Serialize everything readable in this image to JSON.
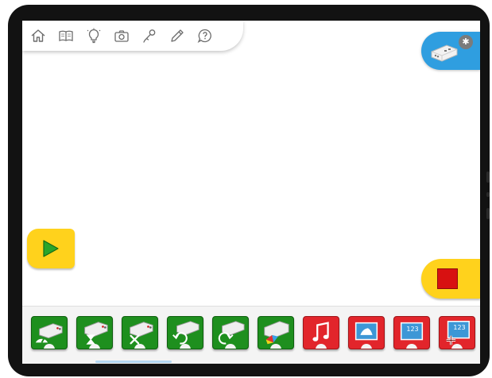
{
  "toolbar": {
    "icons": [
      "home-icon",
      "book-icon",
      "lightbulb-icon",
      "camera-icon",
      "microphone-icon",
      "pencil-icon",
      "help-icon"
    ]
  },
  "hub": {
    "icon": "smarthub-icon",
    "badge_glyph": "✱"
  },
  "controls": {
    "start_icon": "play-triangle-icon",
    "stop_icon": "stop-square-icon"
  },
  "palette": {
    "blocks": [
      {
        "name": "motor-power-block",
        "color": "green"
      },
      {
        "name": "motor-on-for-block",
        "color": "green"
      },
      {
        "name": "motor-off-block",
        "color": "green"
      },
      {
        "name": "motor-anticlockwise-block",
        "color": "green"
      },
      {
        "name": "motor-clockwise-block",
        "color": "green"
      },
      {
        "name": "light-color-block",
        "color": "green"
      },
      {
        "name": "play-sound-block",
        "color": "red"
      },
      {
        "name": "display-image-block",
        "color": "red"
      },
      {
        "name": "display-text-block",
        "color": "red",
        "label": "123"
      },
      {
        "name": "add-to-display-block",
        "color": "red",
        "label": "123"
      }
    ]
  },
  "colors": {
    "accent_blue": "#2f9ee0",
    "yellow": "#ffd21c",
    "green_block": "#1e8f1e",
    "red_block": "#e2252b",
    "play_green": "#2aa52a",
    "stop_red": "#d81111"
  }
}
